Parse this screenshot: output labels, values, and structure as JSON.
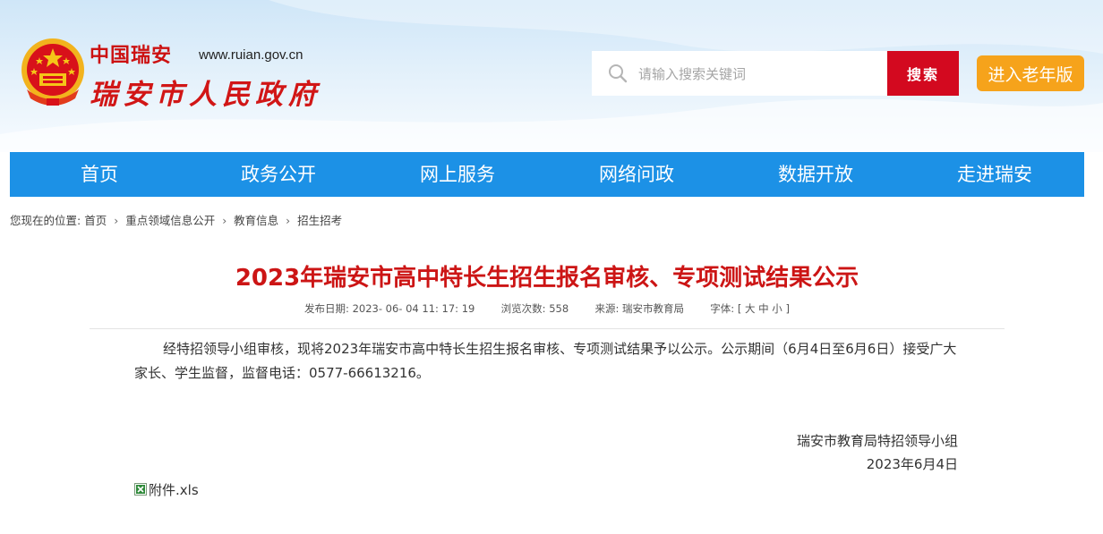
{
  "header": {
    "brand_top": "中国瑞安",
    "brand_url": "www.ruian.gov.cn",
    "brand_name": "瑞安市人民政府",
    "search_placeholder": "请输入搜索关键词",
    "search_label": "搜索",
    "elder_label": "进入老年版"
  },
  "nav": {
    "items": [
      {
        "label": "首页"
      },
      {
        "label": "政务公开"
      },
      {
        "label": "网上服务"
      },
      {
        "label": "网络问政"
      },
      {
        "label": "数据开放"
      },
      {
        "label": "走进瑞安"
      }
    ]
  },
  "breadcrumb": {
    "prefix": "您现在的位置:",
    "items": [
      "首页",
      "重点领域信息公开",
      "教育信息",
      "招生招考"
    ],
    "separator": "›"
  },
  "article": {
    "title": "2023年瑞安市高中特长生招生报名审核、专项测试结果公示",
    "meta": {
      "date_label": "发布日期:",
      "date_value": "2023- 06- 04 11: 17: 19",
      "views_label": "浏览次数:",
      "views_value": "558",
      "source_label": "来源:",
      "source_value": "瑞安市教育局",
      "font_label": "字体:",
      "font_open": "[",
      "font_large": "大",
      "font_medium": "中",
      "font_small": "小",
      "font_close": "]"
    },
    "body": "经特招领导小组审核，现将2023年瑞安市高中特长生招生报名审核、专项测试结果予以公示。公示期间（6月4日至6月6日）接受广大家长、学生监督，监督电话：0577-66613216。",
    "signature_org": "瑞安市教育局特招领导小组",
    "signature_date": "2023年6月4日",
    "attachment_label": "附件.xls"
  },
  "colors": {
    "nav_bg": "#1c91e6",
    "title_red": "#cc1515",
    "search_btn": "#d3091f",
    "elder_btn": "#f6a31b"
  }
}
